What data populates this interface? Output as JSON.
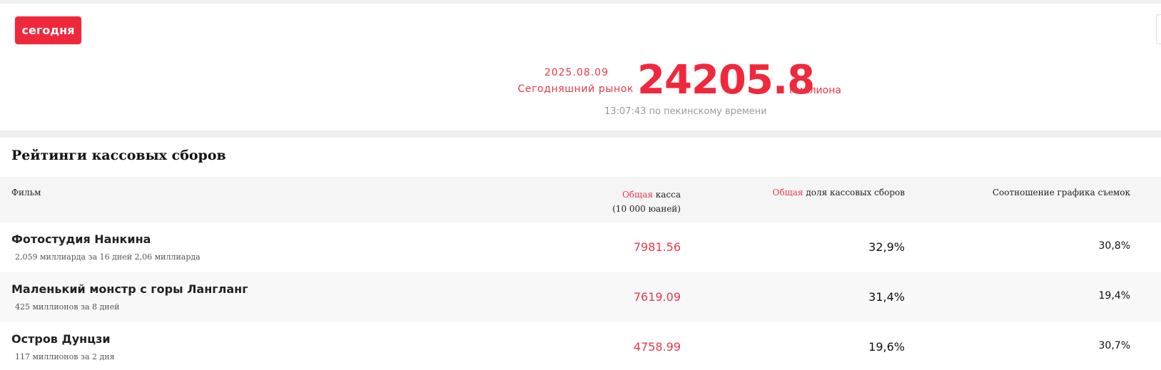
{
  "today_button": "сегодня",
  "market": {
    "date": "2025.08.09",
    "label": "Сегодняшний  рынок",
    "value": "24205.8",
    "unit": "миллиона",
    "time": "13:07:43 по пекинскому времени"
  },
  "ranking": {
    "title": "Рейтинги кассовых сборов",
    "headers": {
      "film": "Фильм",
      "total_accent": "Общая",
      "total_rest": "касса",
      "total_unit": "(10 000 юаней)",
      "share_accent": "Общая",
      "share_rest": "доля кассовых сборов",
      "ratio": "Соотношение графика съемок"
    },
    "rows": [
      {
        "name": "Фотостудия Нанкина",
        "sub": "2,059 миллиарда за 16 дней  2,06 миллиарда",
        "total": "7981.56",
        "share": "32,9%",
        "ratio": "30,8%"
      },
      {
        "name": "Маленький монстр с горы Лангланг",
        "sub": "425 миллионов за 8 дней",
        "total": "7619.09",
        "share": "31,4%",
        "ratio": "19,4%"
      },
      {
        "name": "Остров Дунцзи",
        "sub": "117 миллионов за 2 дня",
        "total": "4758.99",
        "share": "19,6%",
        "ratio": "30,7%"
      }
    ]
  },
  "colors": {
    "accent": "#f0283c",
    "accent_text": "#e8374a",
    "muted": "#9a9a9a",
    "band": "#efefef"
  }
}
